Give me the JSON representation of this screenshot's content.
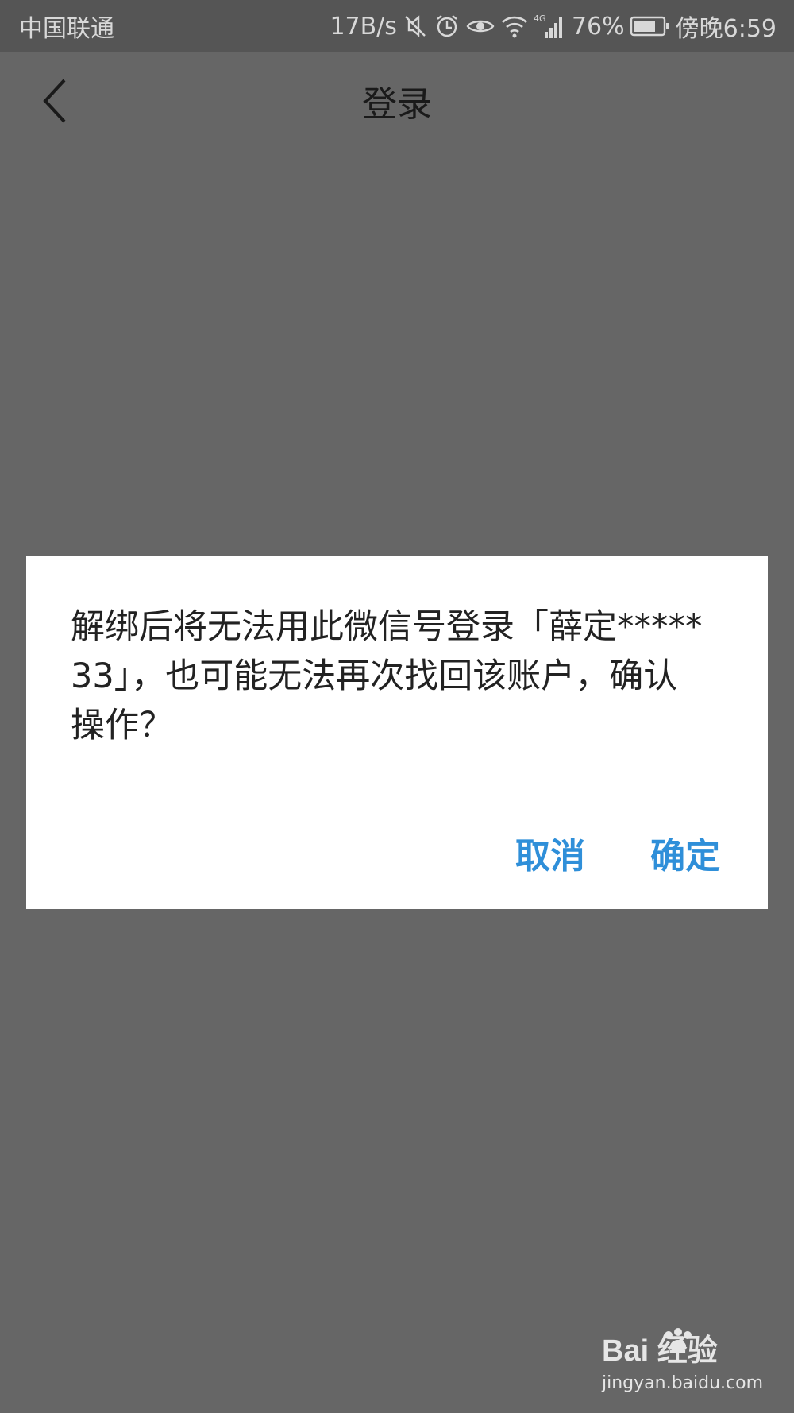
{
  "status_bar": {
    "carrier": "中国联通",
    "speed": "17B/s",
    "network_badge": "4G",
    "battery": "76%",
    "time": "傍晚6:59",
    "icons": [
      "mute-icon",
      "alarm-icon",
      "eye-icon",
      "wifi-icon",
      "signal-icon",
      "battery-icon"
    ]
  },
  "app_bar": {
    "title": "登录",
    "back_icon": "chevron-left-icon"
  },
  "dialog": {
    "message": "解绑后将无法用此微信号登录「薛定*****33」，也可能无法再次找回该账户，确认操作？",
    "cancel_label": "取消",
    "confirm_label": "确定"
  },
  "watermark": {
    "brand": "Bai 经验",
    "url": "jingyan.baidu.com"
  },
  "colors": {
    "accent": "#2f8fd9",
    "overlay": "#666666",
    "status_bar": "#555555"
  }
}
